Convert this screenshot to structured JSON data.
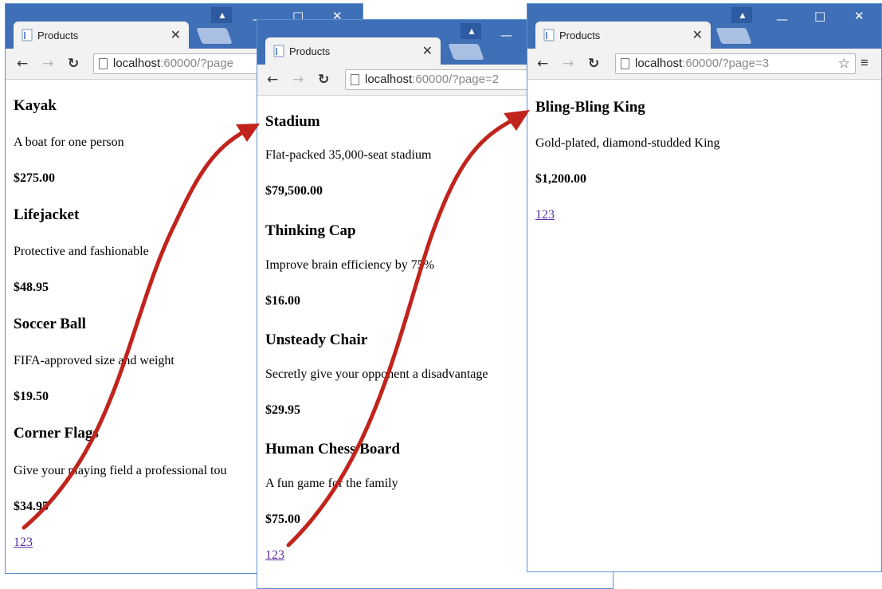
{
  "windows": [
    {
      "tab_title": "Products",
      "url_host": "localhost",
      "url_rest": ":60000/?page",
      "products": [
        {
          "name": "Kayak",
          "description": "A boat for one person",
          "price": "$275.00"
        },
        {
          "name": "Lifejacket",
          "description": "Protective and fashionable",
          "price": "$48.95"
        },
        {
          "name": "Soccer Ball",
          "description": "FIFA-approved size and weight",
          "price": "$19.50"
        },
        {
          "name": "Corner Flags",
          "description": "Give your playing field a professional tou",
          "price": "$34.95"
        }
      ],
      "pagination": "123"
    },
    {
      "tab_title": "Products",
      "url_host": "localhost",
      "url_rest": ":60000/?page=2",
      "products": [
        {
          "name": "Stadium",
          "description": "Flat-packed 35,000-seat stadium",
          "price": "$79,500.00"
        },
        {
          "name": "Thinking Cap",
          "description": "Improve brain efficiency by 75%",
          "price": "$16.00"
        },
        {
          "name": "Unsteady Chair",
          "description": "Secretly give your opponent a disadvantage",
          "price": "$29.95"
        },
        {
          "name": "Human Chess Board",
          "description": "A fun game for the family",
          "price": "$75.00"
        }
      ],
      "pagination": "123"
    },
    {
      "tab_title": "Products",
      "url_host": "localhost",
      "url_rest": ":60000/?page=3",
      "products": [
        {
          "name": "Bling-Bling King",
          "description": "Gold-plated, diamond-studded King",
          "price": "$1,200.00"
        }
      ],
      "pagination": "123"
    }
  ],
  "icons": {
    "back": "arrow-left-icon",
    "forward": "arrow-right-icon",
    "reload": "reload-icon",
    "page": "page-icon",
    "star": "star-icon",
    "menu": "hamburger-menu-icon",
    "user": "user-icon"
  },
  "colors": {
    "titlebar": "#3f6fb6",
    "annotation_arrow": "#c0241c",
    "link": "#5a2da0"
  }
}
